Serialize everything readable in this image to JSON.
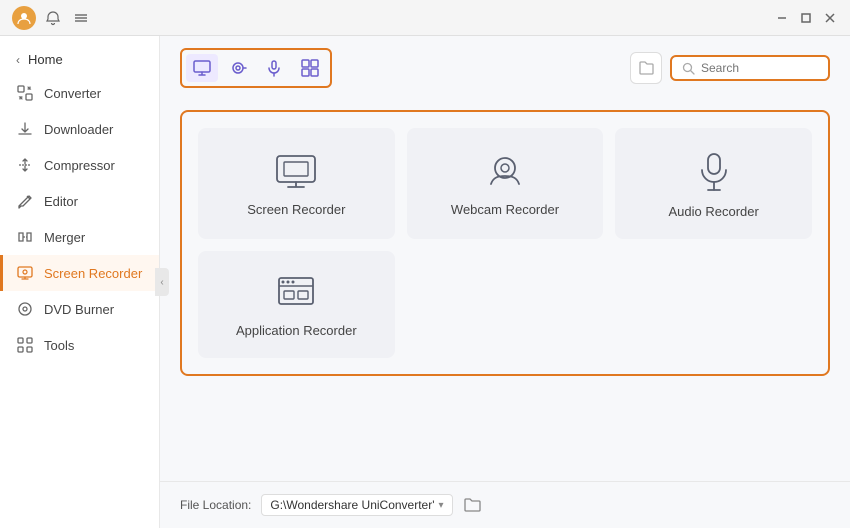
{
  "titlebar": {
    "avatar_text": "U",
    "controls": {
      "minimize": "—",
      "maximize": "□",
      "close": "✕"
    }
  },
  "sidebar": {
    "home_label": "Home",
    "items": [
      {
        "id": "converter",
        "label": "Converter",
        "icon": "converter"
      },
      {
        "id": "downloader",
        "label": "Downloader",
        "icon": "downloader"
      },
      {
        "id": "compressor",
        "label": "Compressor",
        "icon": "compressor"
      },
      {
        "id": "editor",
        "label": "Editor",
        "icon": "editor"
      },
      {
        "id": "merger",
        "label": "Merger",
        "icon": "merger"
      },
      {
        "id": "screen-recorder",
        "label": "Screen Recorder",
        "icon": "screen-recorder",
        "active": true
      },
      {
        "id": "dvd-burner",
        "label": "DVD Burner",
        "icon": "dvd-burner"
      },
      {
        "id": "tools",
        "label": "Tools",
        "icon": "tools"
      }
    ]
  },
  "toolbar": {
    "tabs": [
      {
        "id": "screen",
        "icon": "screen",
        "active": true
      },
      {
        "id": "webcam",
        "icon": "webcam"
      },
      {
        "id": "audio",
        "icon": "audio"
      },
      {
        "id": "app",
        "icon": "app"
      }
    ],
    "search_placeholder": "Search"
  },
  "cards": [
    {
      "id": "screen-recorder",
      "label": "Screen Recorder",
      "icon": "monitor"
    },
    {
      "id": "webcam-recorder",
      "label": "Webcam Recorder",
      "icon": "webcam"
    },
    {
      "id": "audio-recorder",
      "label": "Audio Recorder",
      "icon": "microphone"
    },
    {
      "id": "application-recorder",
      "label": "Application Recorder",
      "icon": "appwindow"
    }
  ],
  "bottom_bar": {
    "label": "File Location:",
    "path": "G:\\Wondershare UniConverter'",
    "path_arrow": "▾"
  }
}
